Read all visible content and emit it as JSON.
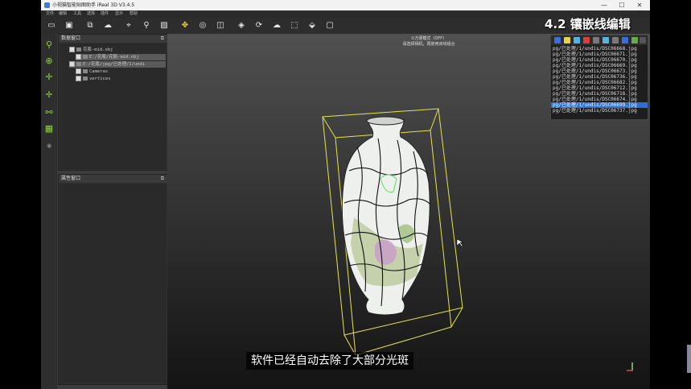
{
  "window": {
    "title": "小视猫智能贴图助手 iReal 3D V3.4.5",
    "controls": [
      "—",
      "☐",
      "✕"
    ]
  },
  "menu": [
    "文件",
    "编辑",
    "工具",
    "选择",
    "插件",
    "显示",
    "帮助"
  ],
  "chapter_overlay": "4.2 镶嵌线编辑",
  "data_panel": {
    "title": "数据窗口",
    "tree": [
      {
        "text": "花瓶-mid.obj",
        "indent": 0,
        "selected": false
      },
      {
        "text": "E:/花瓶/花瓶-mid.obj",
        "indent": 1,
        "selected": true
      },
      {
        "text": "E:/花瓶/jpg/已处理/1/undi",
        "indent": 1,
        "selected": true
      },
      {
        "text": "Cameras",
        "indent": 2,
        "selected": false
      },
      {
        "text": "vertices",
        "indent": 2,
        "selected": false
      }
    ]
  },
  "props_panel": {
    "title": "属性窗口"
  },
  "viewport": {
    "mode_line": "①方便模式（OFF）",
    "hint_line": "请选择相机，再使用双线组合"
  },
  "file_list": {
    "items": [
      "pg/已处理/1/undis/DSC06668.jpg",
      "pg/已处理/1/undis/DSC06671.jpg",
      "pg/已处理/1/undis/DSC06670.jpg",
      "pg/已处理/1/undis/DSC06669.jpg",
      "pg/已处理/1/undis/DSC06673.jpg",
      "pg/已处理/1/undis/DSC06736.jpg",
      "pg/已处理/1/undis/DSC06682.jpg",
      "pg/已处理/1/undis/DSC06712.jpg",
      "pg/已处理/1/undis/DSC06718.jpg",
      "pg/已处理/1/undis/DSC06674.jpg",
      "pg/已处理/1/undis/DSC06699.jpg",
      "pg/已处理/1/undis/DSC06737.jpg"
    ],
    "selected_index": 10,
    "icon_colors": [
      "#3a6fd8",
      "#e8d24a",
      "#4fb3e8",
      "#d84040",
      "#7a7a7a",
      "#5ab0e0",
      "#7a7a7a",
      "#3a6fd8",
      "#6aa84f",
      "#555555"
    ]
  },
  "subtitle": "软件已经自动去除了大部分光斑",
  "colors": {
    "accent": "#8bd53b",
    "bbox": "#e6e44a",
    "selection": "#2e6fd6"
  }
}
